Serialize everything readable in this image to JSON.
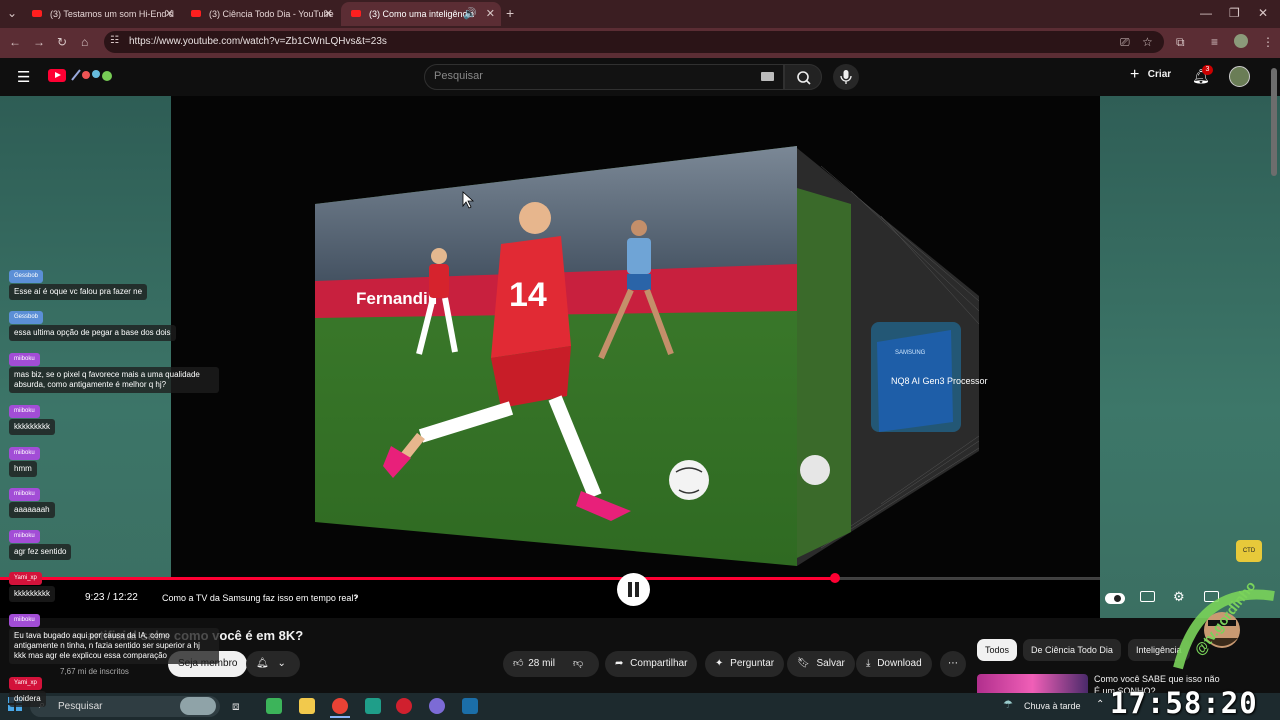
{
  "browser": {
    "tabs": [
      {
        "title": "(3) Testamos um som Hi-End d"
      },
      {
        "title": "(3) Ciência Todo Dia - YouTube"
      },
      {
        "title": "(3) Como uma inteligência"
      }
    ],
    "new_tab": "+",
    "url": "https://www.youtube.com/watch?v=Zb1CWnLQHvs&t=23s"
  },
  "youtube": {
    "search_placeholder": "Pesquisar",
    "create_label": "Criar",
    "notifications_count": "3",
    "player": {
      "time": "9:23 / 12:22",
      "chapter": "Como a TV da Samsung faz isso em tempo real?",
      "progress": 0.7589,
      "processor_label": "NQ8 AI Gen3 Processor",
      "processor_brand": "SAMSUNG",
      "player_number": "14",
      "board_text": "Fernandili"
    },
    "video_title": "... inteligência artificial sabe como você é em 8K?",
    "video_title_visible": "artificial sabe como você é em 8K?",
    "channel": {
      "subscribers": "7,67 mi de inscritos",
      "join_label": "Seja membro"
    },
    "actions": {
      "likes": "28 mil",
      "share": "Compartilhar",
      "ask": "Perguntar",
      "save": "Salvar",
      "download": "Download"
    },
    "chips": [
      "Todos",
      "De Ciência Todo Dia",
      "Inteligência"
    ],
    "recommended": {
      "title_line1": "Como você SABE que isso não",
      "title_line2": "É um SONHO?"
    }
  },
  "chat": [
    {
      "name": "Gessbob",
      "message": "Esse aí é oque vc falou pra fazer ne"
    },
    {
      "name": "Gessbob",
      "message": "essa ultima opção de pegar a base dos dois"
    },
    {
      "name": "miiboku",
      "message": "mas biz, se o pixel q favorece mais a uma qualidade absurda, como antigamente é melhor q hj?"
    },
    {
      "name": "miiboku",
      "message": "kkkkkkkkk"
    },
    {
      "name": "miiboku",
      "message": "hmm"
    },
    {
      "name": "miiboku",
      "message": "aaaaaaah"
    },
    {
      "name": "miiboku",
      "message": "agr fez sentido"
    },
    {
      "name": "Yami_xp",
      "message": "kkkkkkkkk"
    },
    {
      "name": "miiboku",
      "message": "Eu tava bugado aqui por causa da IA, como antigamente n tinha, n fazia sentido ser superior a hj kkk mas agr ele explicou essa comparação"
    },
    {
      "name": "Yami_xp",
      "message": "doidera"
    }
  ],
  "overlay": {
    "streamer_tag": "@tv.gordinho",
    "clock": "17:58:20"
  },
  "taskbar": {
    "search_label": "Pesquisar",
    "weather": "Chuva à tarde"
  },
  "colors": {
    "yt_red": "#ff0033",
    "tab_bg": "#3b1e22",
    "toolbar_bg": "#5b2d34",
    "chat_name_bg": "#a24dd6",
    "chat_name_red": "#d3123a"
  }
}
